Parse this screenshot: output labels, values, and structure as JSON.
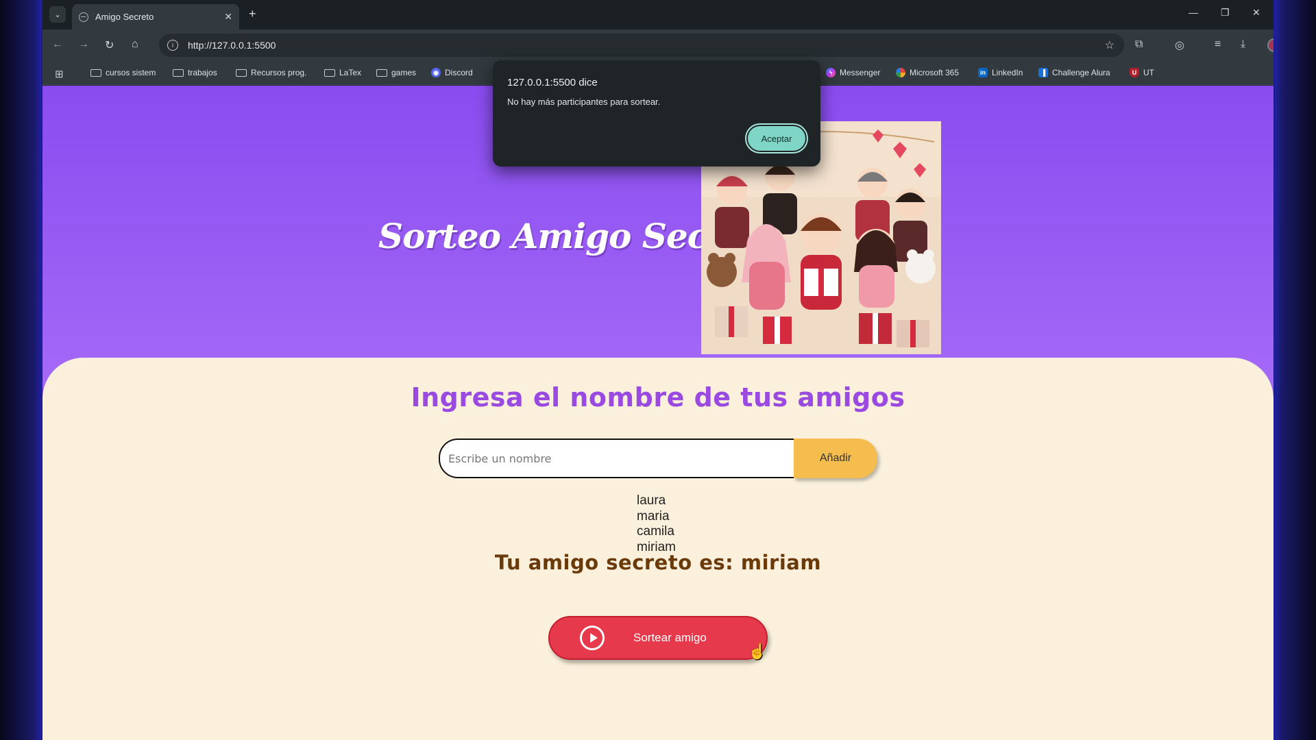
{
  "browser": {
    "tab_title": "Amigo Secreto",
    "url": "http://127.0.0.1:5500",
    "bookmarks": [
      {
        "label": "cursos sistem",
        "icon": "folder-icon"
      },
      {
        "label": "trabajos",
        "icon": "folder-icon"
      },
      {
        "label": "Recursos prog.",
        "icon": "folder-icon"
      },
      {
        "label": "LaTex",
        "icon": "folder-icon"
      },
      {
        "label": "games",
        "icon": "folder-icon"
      },
      {
        "label": "Discord",
        "icon": "discord-icon"
      },
      {
        "label": "Messenger",
        "icon": "messenger-icon"
      },
      {
        "label": "Microsoft 365",
        "icon": "microsoft365-icon"
      },
      {
        "label": "LinkedIn",
        "icon": "linkedin-icon"
      },
      {
        "label": "Challenge Alura",
        "icon": "trello-icon"
      },
      {
        "label": "UT",
        "icon": "ut-icon"
      }
    ]
  },
  "dialog": {
    "title": "127.0.0.1:5500 dice",
    "message": "No hay más participantes para sortear.",
    "ok_label": "Aceptar"
  },
  "page": {
    "hero_title": "Sorteo Amigo Secreto",
    "section_title": "Ingresa el nombre de tus amigos",
    "input_placeholder": "Escribe un nombre",
    "add_label": "Añadir",
    "friends": [
      "laura",
      "maria",
      "camila",
      "miriam"
    ],
    "result": "Tu amigo secreto es: miriam",
    "draw_label": "Sortear amigo"
  },
  "colors": {
    "header_purple": "#8a4cf0",
    "content_cream": "#faf0dc",
    "title_purple": "#9a4ae0",
    "result_brown": "#6b3a0a",
    "add_yellow": "#f4bd4d",
    "draw_red": "#e63a4c",
    "dialog_ok": "#7fd6c6"
  }
}
